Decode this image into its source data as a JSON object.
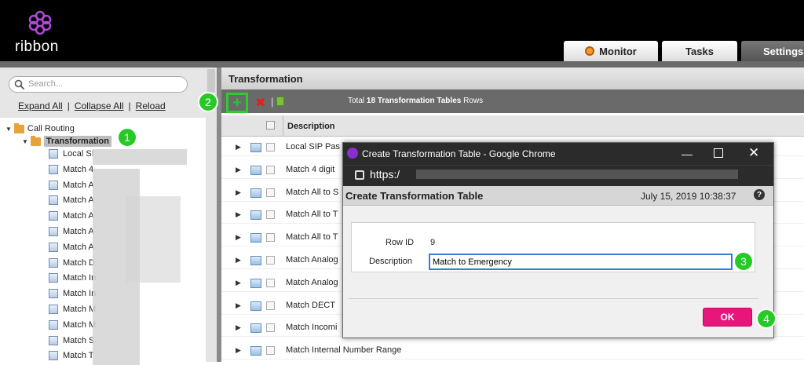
{
  "header": {
    "logo_text": "ribbon",
    "tabs": [
      {
        "label": "Monitor"
      },
      {
        "label": "Tasks"
      },
      {
        "label": "Settings"
      }
    ]
  },
  "sidebar": {
    "search_placeholder": "Search...",
    "links": {
      "expand_all": "Expand All",
      "collapse_all": "Collapse All",
      "reload": "Reload"
    },
    "tree": {
      "root": "Call Routing",
      "selected": "Transformation",
      "items": [
        "Local SI",
        "Match 4",
        "Match A",
        "Match A",
        "Match A",
        "Match A",
        "Match A",
        "Match D",
        "Match In",
        "Match In",
        "Match M",
        "Match M",
        "Match S",
        "Match T"
      ]
    }
  },
  "main": {
    "title": "Transformation",
    "toolbar": {
      "total_prefix": "Total",
      "total_count": "18",
      "total_suffix": "Transformation Tables",
      "rows_word": "Rows"
    },
    "table": {
      "header_description": "Description",
      "rows": [
        "Local SIP Pas",
        "Match 4 digit",
        "Match All to S",
        "Match All to T",
        "Match All to T",
        "Match Analog",
        "Match Analog",
        "Match DECT",
        "Match Incomi",
        "Match Internal Number Range"
      ]
    }
  },
  "dialog": {
    "window_title": "Create Transformation Table - Google Chrome",
    "url": "https:/",
    "heading": "Create Transformation Table",
    "date": "July 15, 2019 10:38:37",
    "help": "?",
    "row_id_label": "Row ID",
    "row_id_value": "9",
    "description_label": "Description",
    "description_value": "Match to Emergency",
    "ok_label": "OK"
  },
  "badges": [
    "1",
    "2",
    "3",
    "4"
  ],
  "colors": {
    "accent_green": "#27c927",
    "ok_pink": "#e8157a",
    "brand_purple": "#8b2ed0"
  }
}
